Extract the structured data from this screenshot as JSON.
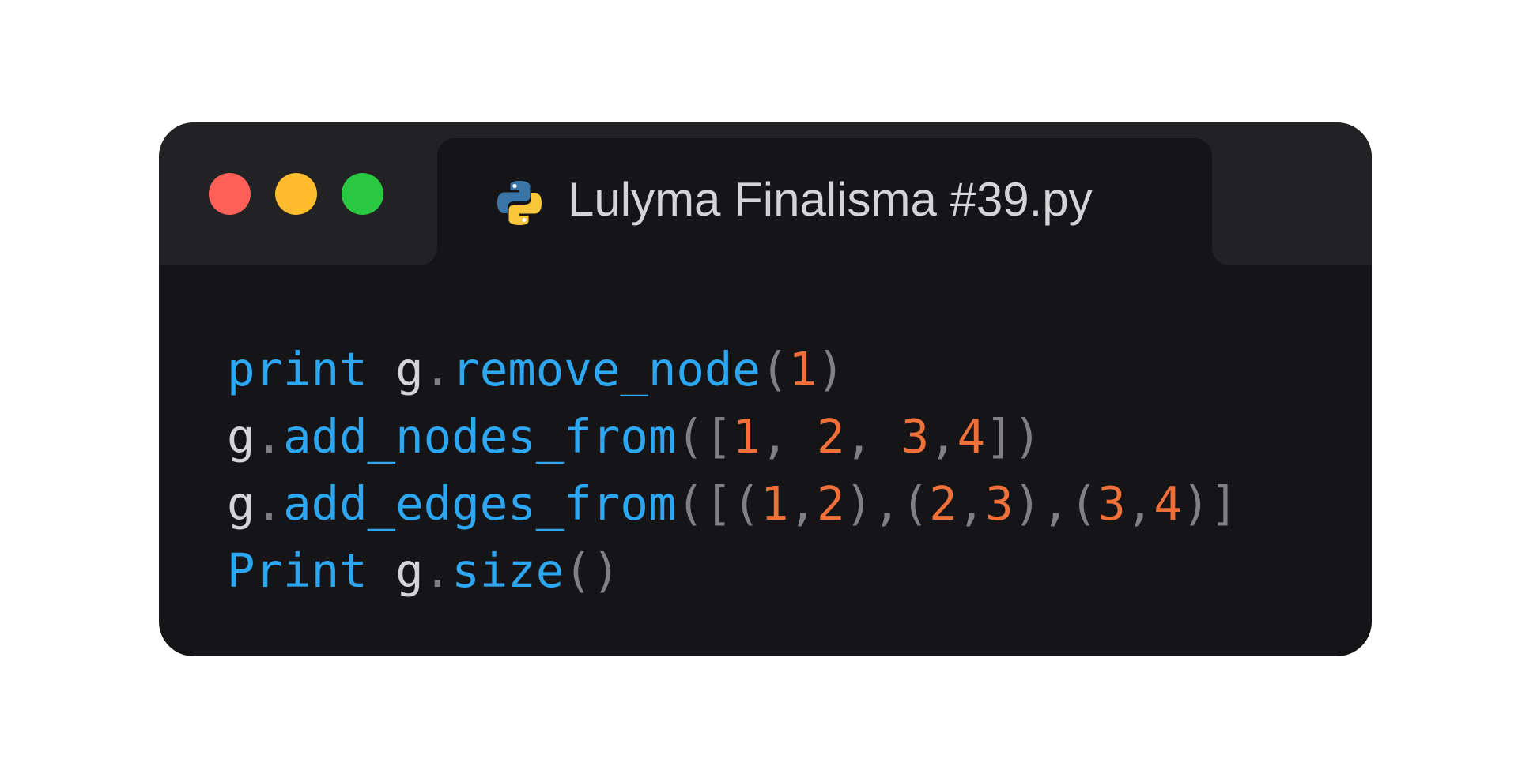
{
  "window": {
    "traffic_lights": [
      {
        "name": "close-button",
        "color": "#fe5f57"
      },
      {
        "name": "minimize-button",
        "color": "#febc2e"
      },
      {
        "name": "maximize-button",
        "color": "#28c840"
      }
    ],
    "tab": {
      "icon": "python-icon",
      "title": "Lulyma Finalisma #39.py"
    }
  },
  "colors": {
    "keyword": "#2ea7f2",
    "plain": "#d4d4d6",
    "number": "#f0703a",
    "punct": "#808084"
  },
  "code": {
    "lines": [
      [
        {
          "text": "print",
          "kind": "keyword"
        },
        {
          "text": " ",
          "kind": "plain"
        },
        {
          "text": "g",
          "kind": "plain"
        },
        {
          "text": ".",
          "kind": "punct"
        },
        {
          "text": "remove_node",
          "kind": "keyword"
        },
        {
          "text": "(",
          "kind": "punct"
        },
        {
          "text": "1",
          "kind": "number"
        },
        {
          "text": ")",
          "kind": "punct"
        }
      ],
      [
        {
          "text": "g",
          "kind": "plain"
        },
        {
          "text": ".",
          "kind": "punct"
        },
        {
          "text": "add_nodes_from",
          "kind": "keyword"
        },
        {
          "text": "([",
          "kind": "punct"
        },
        {
          "text": "1",
          "kind": "number"
        },
        {
          "text": ", ",
          "kind": "punct"
        },
        {
          "text": "2",
          "kind": "number"
        },
        {
          "text": ", ",
          "kind": "punct"
        },
        {
          "text": "3",
          "kind": "number"
        },
        {
          "text": ",",
          "kind": "punct"
        },
        {
          "text": "4",
          "kind": "number"
        },
        {
          "text": "])",
          "kind": "punct"
        }
      ],
      [
        {
          "text": "g",
          "kind": "plain"
        },
        {
          "text": ".",
          "kind": "punct"
        },
        {
          "text": "add_edges_from",
          "kind": "keyword"
        },
        {
          "text": "([(",
          "kind": "punct"
        },
        {
          "text": "1",
          "kind": "number"
        },
        {
          "text": ",",
          "kind": "punct"
        },
        {
          "text": "2",
          "kind": "number"
        },
        {
          "text": "),(",
          "kind": "punct"
        },
        {
          "text": "2",
          "kind": "number"
        },
        {
          "text": ",",
          "kind": "punct"
        },
        {
          "text": "3",
          "kind": "number"
        },
        {
          "text": "),(",
          "kind": "punct"
        },
        {
          "text": "3",
          "kind": "number"
        },
        {
          "text": ",",
          "kind": "punct"
        },
        {
          "text": "4",
          "kind": "number"
        },
        {
          "text": ")]",
          "kind": "punct"
        }
      ],
      [
        {
          "text": "Print",
          "kind": "keyword"
        },
        {
          "text": " ",
          "kind": "plain"
        },
        {
          "text": "g",
          "kind": "plain"
        },
        {
          "text": ".",
          "kind": "punct"
        },
        {
          "text": "size",
          "kind": "keyword"
        },
        {
          "text": "()",
          "kind": "punct"
        }
      ]
    ]
  }
}
